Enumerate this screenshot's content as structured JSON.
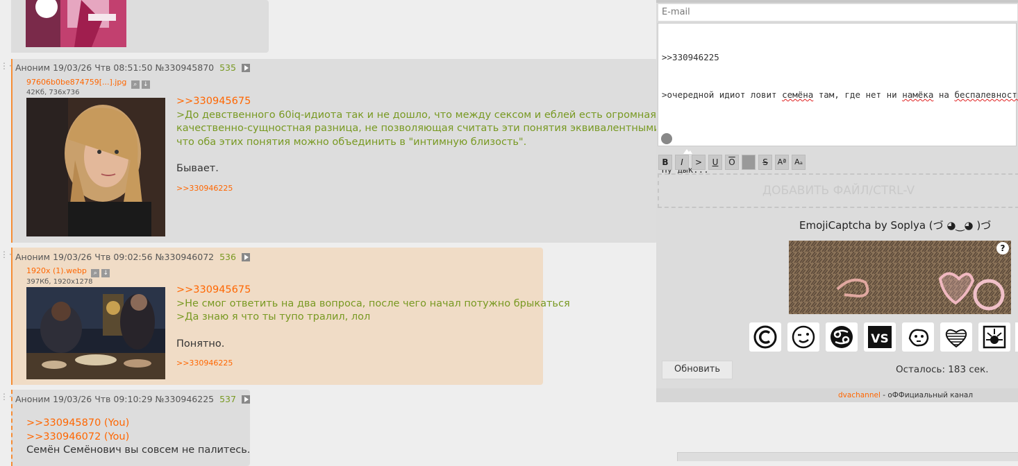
{
  "posts": [
    {
      "author": "Аноним",
      "date": "19/03/26 Чтв 08:51:50",
      "id": "№330945870",
      "num": "535",
      "file_name": "97606b0be874759[...].jpg",
      "file_meta": "42Кб, 736x736",
      "lines": [
        ">>330945675",
        ">До девственного 60iq-идиота так и не дошло, что между сексом и еблей есть огромная",
        "качественно-сущностная разница, не позволяющая считать эти понятия эквивалентными при том,",
        "что оба этих понятия можно объединить в \"интимную близость\".",
        "Бывает."
      ],
      "reply": ">>330946225"
    },
    {
      "author": "Аноним",
      "date": "19/03/26 Чтв 09:02:56",
      "id": "№330946072",
      "num": "536",
      "file_name": "1920x (1).webp",
      "file_meta": "397Кб, 1920x1278",
      "lines": [
        ">>330945675",
        ">Не смог ответить на два вопроса, после чего начал потужно брыкаться",
        ">Да знаю я что ты тупо тралил, лол",
        "Понятно."
      ],
      "reply": ">>330946225"
    },
    {
      "author": "Аноним",
      "date": "19/03/26 Чтв 09:10:29",
      "id": "№330946225",
      "num": "537",
      "lines": [
        ">>330945870 (You)",
        ">>330946072 (You)",
        "Семён Семёнович вы совсем не палитесь."
      ]
    }
  ],
  "form": {
    "email_placeholder": "E-mail",
    "text_line1": ">>330946225",
    "text_line2_a": ">очередной идиот ловит ",
    "text_line2_b": "семёна",
    "text_line2_c": " там, где нет ни ",
    "text_line2_d": "намёка",
    "text_line2_e": " на ",
    "text_line2_f": "беспалевность",
    "text_line2_g": ".",
    "text_line4": "Ну дык...",
    "toolbar": [
      "B",
      "I",
      ">",
      "U",
      "O",
      "",
      "S",
      "Aª",
      "Aₐ"
    ],
    "add_file": "ДОБАВИТЬ ФАЙЛ/CTRL-V",
    "captcha_title": "EmojiCaptcha by Soplya (づ ◕‿◕ )づ",
    "captcha_help": "?",
    "emoji_icons": [
      "copyright-icon",
      "wink-face-icon",
      "cancer-zodiac-icon",
      "vs-icon",
      "lion-icon",
      "striped-heart-icon",
      "sunset-icon"
    ],
    "refresh_label": "Обновить",
    "timer_text": "Осталось: 183 сек.",
    "channel_link": "dvachannel",
    "channel_suffix": " - оФФициальный канал"
  }
}
